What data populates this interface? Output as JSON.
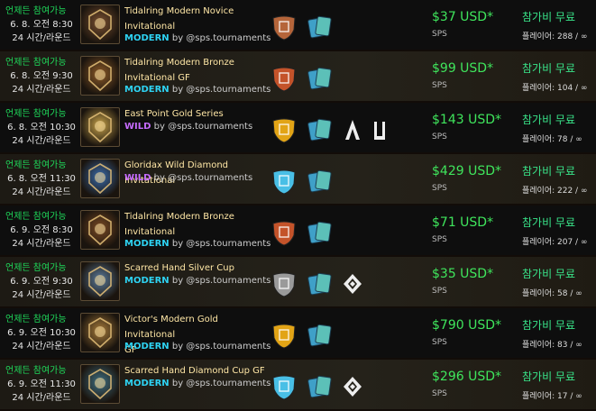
{
  "tournaments": [
    {
      "open": "언제든 참여가능",
      "date": "6. 8. 오전 8:30",
      "round": "24 시간/라운드",
      "title_lines": [
        "Tidalring Modern Novice",
        "Invitational"
      ],
      "format": "MODERN",
      "by": "by @sps.tournaments",
      "league_icon": "novice-league-shield-icon",
      "league_color": "#b5653a",
      "extra_icons": [],
      "prize": "$37 USD*",
      "prize_token": "SPS",
      "fee": "참가비 무료",
      "players": "플레이어: 288 / ∞",
      "theme": "dark",
      "thumb": "tidalring-emblem-icon",
      "thumb_color": "#7a5030"
    },
    {
      "open": "언제든 참여가능",
      "date": "6. 8. 오전 9:30",
      "round": "24 시간/라운드",
      "title_lines": [
        "Tidalring Modern Bronze",
        "Invitational GF"
      ],
      "format": "MODERN",
      "by": "by @sps.tournaments",
      "league_icon": "bronze-league-shield-icon",
      "league_color": "#c4532a",
      "extra_icons": [],
      "prize": "$99 USD*",
      "prize_token": "SPS",
      "fee": "참가비 무료",
      "players": "플레이어: 104 / ∞",
      "theme": "light",
      "thumb": "tidalring-emblem-icon",
      "thumb_color": "#8c5a28"
    },
    {
      "open": "언제든 참여가능",
      "date": "6. 8. 오전 10:30",
      "round": "24 시간/라운드",
      "title_lines": [
        "East Point Gold Series"
      ],
      "format": "WILD",
      "by": "by @sps.tournaments",
      "league_icon": "gold-league-shield-icon",
      "league_color": "#e2a416",
      "extra_icons": [
        "ruleset-a-icon",
        "ruleset-u-icon"
      ],
      "prize": "$143 USD*",
      "prize_token": "SPS",
      "fee": "참가비 무료",
      "players": "플레이어: 78 / ∞",
      "theme": "dark",
      "thumb": "east-point-emblem-icon",
      "thumb_color": "#c7a24a"
    },
    {
      "open": "언제든 참여가능",
      "date": "6. 8. 오전 11:30",
      "round": "24 시간/라운드",
      "title_lines": [
        "Gloridax Wild Diamond Invitational"
      ],
      "format": "WILD",
      "by": "by @sps.tournaments",
      "league_icon": "diamond-league-shield-icon",
      "league_color": "#49bfe6",
      "extra_icons": [],
      "prize": "$429 USD*",
      "prize_token": "SPS",
      "fee": "참가비 무료",
      "players": "플레이어: 222 / ∞",
      "theme": "light",
      "thumb": "gloridax-emblem-icon",
      "thumb_color": "#3a6aa8"
    },
    {
      "open": "언제든 참여가능",
      "date": "6. 9. 오전 8:30",
      "round": "24 시간/라운드",
      "title_lines": [
        "Tidalring Modern Bronze",
        "Invitational"
      ],
      "format": "MODERN",
      "by": "by @sps.tournaments",
      "league_icon": "bronze-league-shield-icon",
      "league_color": "#c4532a",
      "extra_icons": [],
      "prize": "$71 USD*",
      "prize_token": "SPS",
      "fee": "참가비 무료",
      "players": "플레이어: 207 / ∞",
      "theme": "dark",
      "thumb": "tidalring-emblem-icon",
      "thumb_color": "#7a4a24"
    },
    {
      "open": "언제든 참여가능",
      "date": "6. 9. 오전 9:30",
      "round": "24 시간/라운드",
      "title_lines": [
        "Scarred Hand Silver Cup"
      ],
      "format": "MODERN",
      "by": "by @sps.tournaments",
      "league_icon": "silver-league-shield-icon",
      "league_color": "#9a9a9a",
      "extra_icons": [
        "ruleset-diamond-knot-icon"
      ],
      "prize": "$35 USD*",
      "prize_token": "SPS",
      "fee": "참가비 무료",
      "players": "플레이어: 58 / ∞",
      "theme": "light",
      "thumb": "scarred-hand-emblem-icon",
      "thumb_color": "#5a7a9a"
    },
    {
      "open": "언제든 참여가능",
      "date": "6. 9. 오전 10:30",
      "round": "24 시간/라운드",
      "title_lines": [
        "Victor's Modern Gold Invitational",
        "GF"
      ],
      "format": "MODERN",
      "by": "by @sps.tournaments",
      "league_icon": "gold-league-shield-icon",
      "league_color": "#e2a416",
      "extra_icons": [],
      "prize": "$790 USD*",
      "prize_token": "SPS",
      "fee": "참가비 무료",
      "players": "플레이어: 83 / ∞",
      "theme": "dark",
      "thumb": "victor-emblem-icon",
      "thumb_color": "#a67a3a"
    },
    {
      "open": "언제든 참여가능",
      "date": "6. 9. 오전 11:30",
      "round": "24 시간/라운드",
      "title_lines": [
        "Scarred Hand Diamond Cup GF"
      ],
      "format": "MODERN",
      "by": "by @sps.tournaments",
      "league_icon": "diamond-league-shield-icon",
      "league_color": "#49bfe6",
      "extra_icons": [
        "ruleset-diamond-knot-icon"
      ],
      "prize": "$296 USD*",
      "prize_token": "SPS",
      "fee": "참가비 무료",
      "players": "플레이어: 17 / ∞",
      "theme": "light",
      "thumb": "scarred-hand-emblem-icon",
      "thumb_color": "#3f6e80"
    }
  ],
  "colors": {
    "open": "#1fd85a",
    "prize": "#3fe55c",
    "fee": "#39e58a",
    "title": "#ffe7a6",
    "modern": "#2ed3f3",
    "wild": "#c76cff"
  }
}
